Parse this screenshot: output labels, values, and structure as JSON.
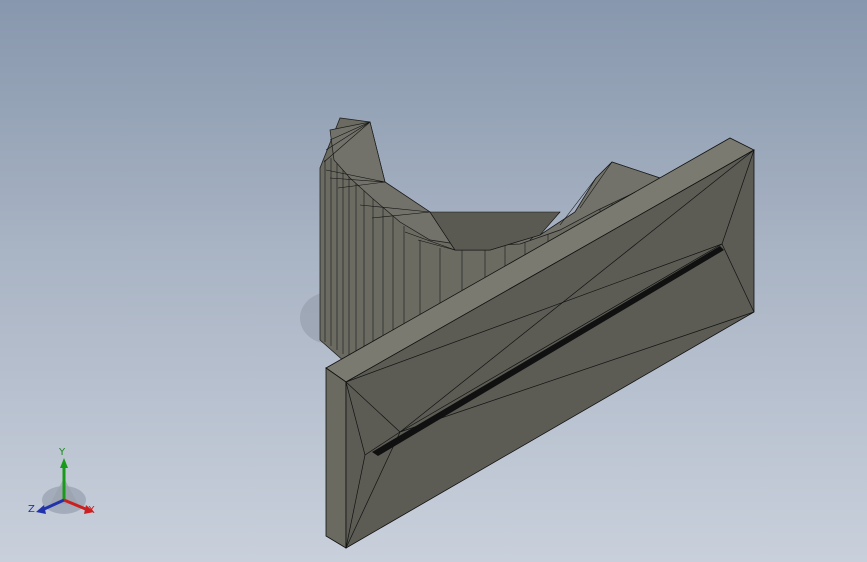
{
  "triad": {
    "x_label": "X",
    "y_label": "Y",
    "z_label": "Z",
    "colors": {
      "x": "#cc2020",
      "y": "#1a9a1a",
      "z": "#2233aa"
    }
  },
  "scene": {
    "background_top": "#8797ad",
    "background_bottom": "#c9d0dc",
    "model_fill": "#5e5e56",
    "model_edge": "#111111"
  }
}
